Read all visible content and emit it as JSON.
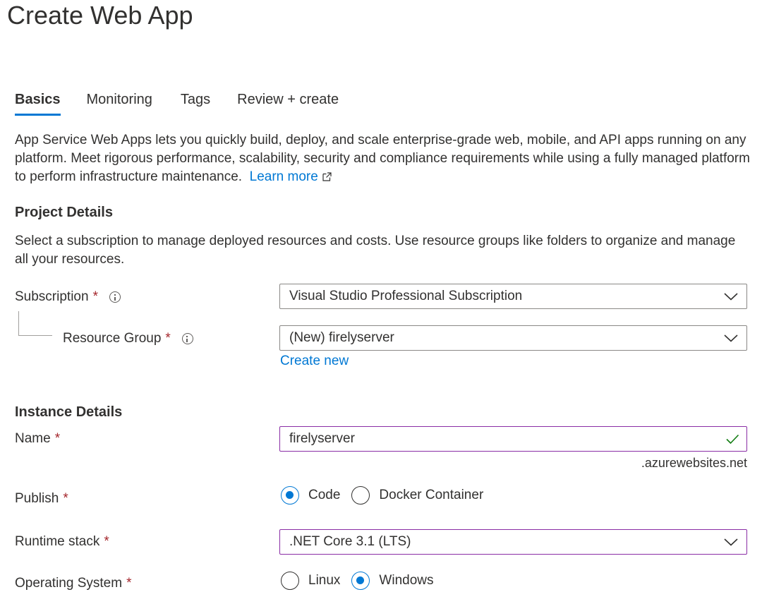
{
  "page": {
    "title": "Create Web App"
  },
  "tabs": [
    {
      "label": "Basics",
      "active": true
    },
    {
      "label": "Monitoring",
      "active": false
    },
    {
      "label": "Tags",
      "active": false
    },
    {
      "label": "Review + create",
      "active": false
    }
  ],
  "intro": {
    "text": "App Service Web Apps lets you quickly build, deploy, and scale enterprise-grade web, mobile, and API apps running on any platform. Meet rigorous performance, scalability, security and compliance requirements while using a fully managed platform to perform infrastructure maintenance.",
    "learn_more": "Learn more"
  },
  "project_details": {
    "heading": "Project Details",
    "description": "Select a subscription to manage deployed resources and costs. Use resource groups like folders to organize and manage all your resources.",
    "subscription": {
      "label": "Subscription",
      "value": "Visual Studio Professional Subscription"
    },
    "resource_group": {
      "label": "Resource Group",
      "value": "(New) firelyserver",
      "create_new": "Create new"
    }
  },
  "instance_details": {
    "heading": "Instance Details",
    "name": {
      "label": "Name",
      "value": "firelyserver",
      "suffix": ".azurewebsites.net"
    },
    "publish": {
      "label": "Publish",
      "options": [
        "Code",
        "Docker Container"
      ],
      "selected": "Code"
    },
    "runtime_stack": {
      "label": "Runtime stack",
      "value": ".NET Core 3.1 (LTS)"
    },
    "operating_system": {
      "label": "Operating System",
      "options": [
        "Linux",
        "Windows"
      ],
      "selected": "Windows"
    }
  },
  "required_marker": "*",
  "colors": {
    "accent": "#0078d4",
    "required": "#a4262c",
    "focus_border": "#8a2da5",
    "valid": "#107c10"
  },
  "icons": [
    "info-icon",
    "chevron-down-icon",
    "checkmark-icon",
    "external-link-icon"
  ]
}
